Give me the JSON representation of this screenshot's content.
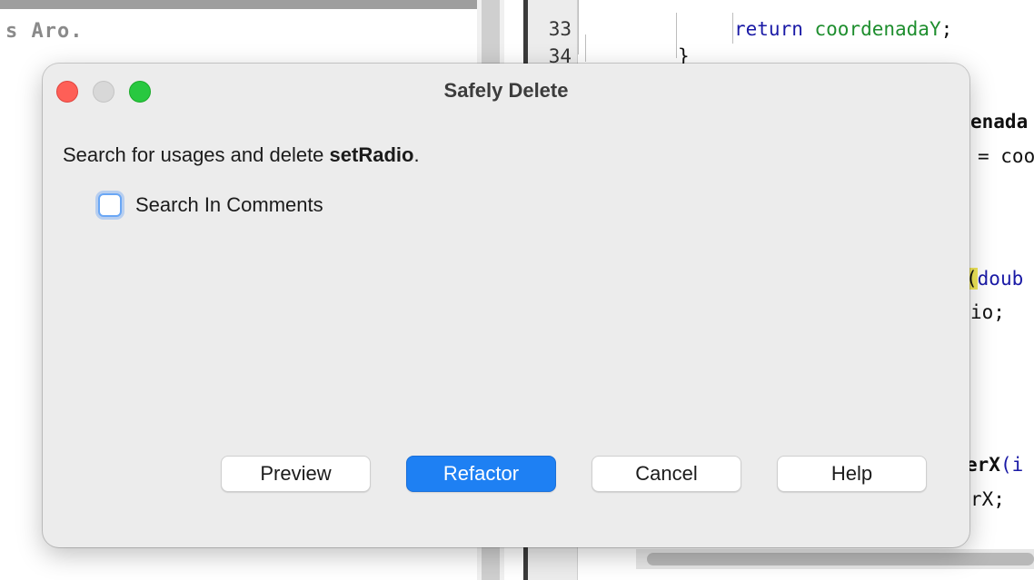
{
  "background": {
    "left_code_fragment": "s Aro.",
    "line_numbers": [
      "33",
      "34"
    ],
    "code_lines": [
      {
        "kw": "return",
        "id": "coordenadaY",
        "tail": ";"
      },
      {
        "text": "}"
      }
    ],
    "right_fragments": {
      "f1": "enada",
      "f2": "= coo",
      "f3_hl": "(",
      "f3_kw": "doub",
      "f4": "io;",
      "f5": "erX",
      "f5b": "(i",
      "f6": "rX;"
    }
  },
  "dialog": {
    "title": "Safely Delete",
    "message_prefix": "Search for usages and delete ",
    "message_target": "setRadio",
    "message_suffix": ".",
    "checkbox_label": "Search In Comments",
    "checkbox_checked": false,
    "buttons": {
      "preview": "Preview",
      "refactor": "Refactor",
      "cancel": "Cancel",
      "help": "Help"
    }
  },
  "colors": {
    "accent": "#1e80f3",
    "close": "#fe5f57",
    "maximize": "#28c840"
  }
}
